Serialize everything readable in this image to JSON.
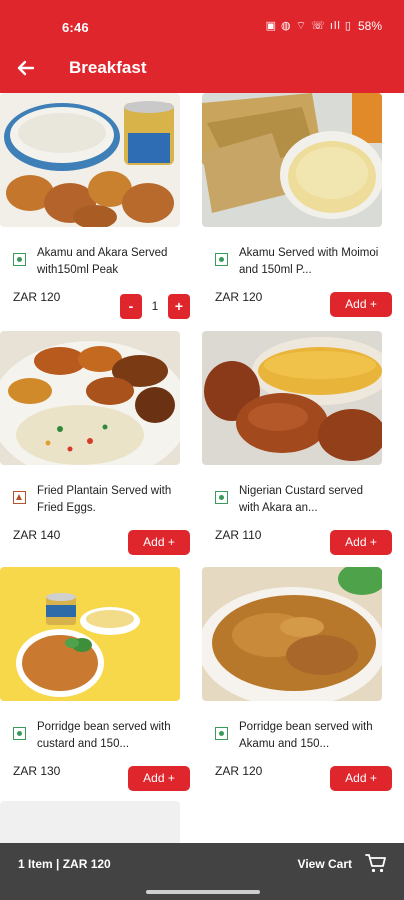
{
  "status_bar": {
    "time": "6:46",
    "battery": "58%",
    "icons": "▣ ◍ ⌔ ☏ ıll ▯"
  },
  "header": {
    "title": "Breakfast",
    "accent": "#e0262d"
  },
  "products": [
    {
      "name": "Akamu and Akara Served with150ml Peak",
      "price": "ZAR 120",
      "diet": "veg",
      "in_cart": true,
      "quantity": "1",
      "minus": "-",
      "plus": "+"
    },
    {
      "name": "Akamu Served with Moimoi and 150ml P...",
      "price": "ZAR 120",
      "diet": "veg",
      "in_cart": false,
      "add_label": "Add +"
    },
    {
      "name": "Fried Plantain Served with Fried Eggs.",
      "price": "ZAR 140",
      "diet": "nonveg",
      "in_cart": false,
      "add_label": "Add +"
    },
    {
      "name": "Nigerian Custard served with Akara an...",
      "price": "ZAR 110",
      "diet": "veg",
      "in_cart": false,
      "add_label": "Add +"
    },
    {
      "name": "Porridge bean served with custard and 150...",
      "price": "ZAR 130",
      "diet": "veg",
      "in_cart": false,
      "add_label": "Add +"
    },
    {
      "name": "Porridge bean served with Akamu and 150...",
      "price": "ZAR 120",
      "diet": "veg",
      "in_cart": false,
      "add_label": "Add +"
    }
  ],
  "cart": {
    "summary": "1 Item | ZAR 120",
    "view_label": "View Cart",
    "bar_color": "#434343"
  }
}
